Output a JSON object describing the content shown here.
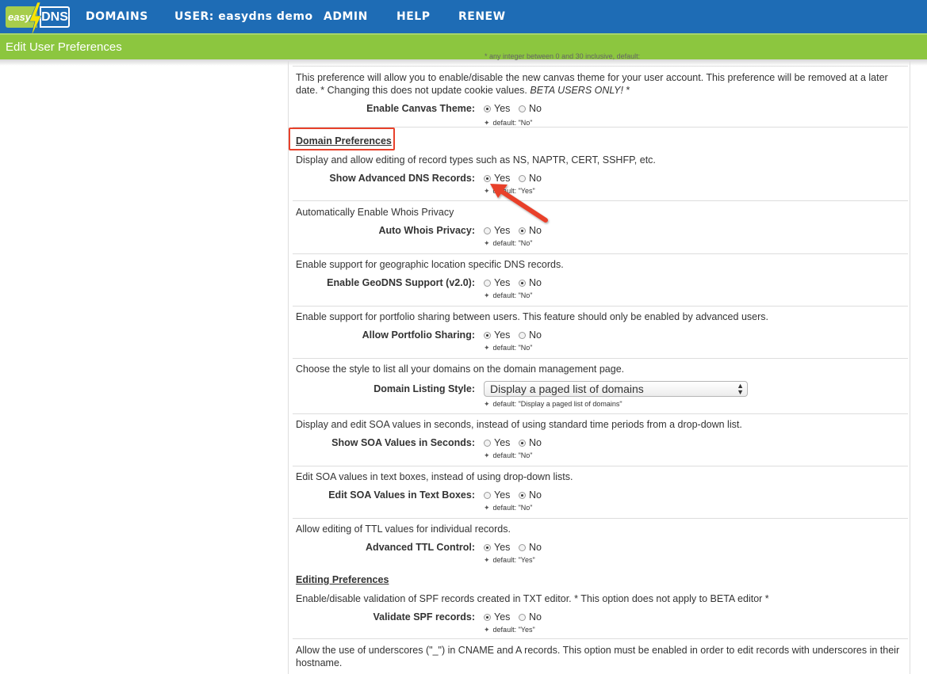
{
  "logo": {
    "part1": "easy",
    "part2": "DNS"
  },
  "nav": [
    "DOMAINS",
    "USER: easydns demo",
    "ADMIN",
    "HELP",
    "RENEW"
  ],
  "page_title": "Edit User Preferences",
  "top_cutoff_text": "* any integer between 0 and 30 inclusive, default:",
  "canvas": {
    "desc": "This preference will allow you to enable/disable the new canvas theme for your user account. This preference will be removed at a later date. * Changing this does not update cookie values.",
    "desc_italic": "BETA USERS ONLY!",
    "desc_tail": " *",
    "label": "Enable Canvas Theme:",
    "selected": "Yes",
    "default": "default: \"No\""
  },
  "domain_section": "Domain Preferences",
  "prefs": [
    {
      "desc": "Display and allow editing of record types such as NS, NAPTR, CERT, SSHFP, etc.",
      "label": "Show Advanced DNS Records:",
      "selected": "Yes",
      "default": "default: \"Yes\""
    },
    {
      "desc": "Automatically Enable Whois Privacy",
      "label": "Auto Whois Privacy:",
      "selected": "No",
      "default": "default: \"No\""
    },
    {
      "desc": "Enable support for geographic location specific DNS records.",
      "label": "Enable GeoDNS Support (v2.0):",
      "selected": "No",
      "default": "default: \"No\""
    },
    {
      "desc": "Enable support for portfolio sharing between users. This feature should only be enabled by advanced users.",
      "label": "Allow Portfolio Sharing:",
      "selected": "Yes",
      "default": "default: \"No\""
    }
  ],
  "listing": {
    "desc": "Choose the style to list all your domains on the domain management page.",
    "label": "Domain Listing Style:",
    "value": "Display a paged list of domains",
    "default": "default: \"Display a paged list of domains\""
  },
  "prefs2": [
    {
      "desc": "Display and edit SOA values in seconds, instead of using standard time periods from a drop-down list.",
      "label": "Show SOA Values in Seconds:",
      "selected": "No",
      "default": "default: \"No\""
    },
    {
      "desc": "Edit SOA values in text boxes, instead of using drop-down lists.",
      "label": "Edit SOA Values in Text Boxes:",
      "selected": "No",
      "default": "default: \"No\""
    },
    {
      "desc": "Allow editing of TTL values for individual records.",
      "label": "Advanced TTL Control:",
      "selected": "Yes",
      "default": "default: \"Yes\""
    }
  ],
  "editing_section": "Editing Preferences",
  "spf": {
    "desc": "Enable/disable validation of SPF records created in TXT editor. * This option does not apply to BETA editor *",
    "label": "Validate SPF records:",
    "selected": "Yes",
    "default": "default: \"Yes\""
  },
  "underscore": {
    "desc": "Allow the use of underscores (\"_\") in CNAME and A records. This option must be enabled in order to edit records with underscores in their hostname."
  },
  "option_labels": {
    "yes": "Yes",
    "no": "No"
  },
  "colors": {
    "nav_blue": "#1e6cb5",
    "sub_green": "#8cc63f",
    "highlight_red": "#e8412b"
  }
}
